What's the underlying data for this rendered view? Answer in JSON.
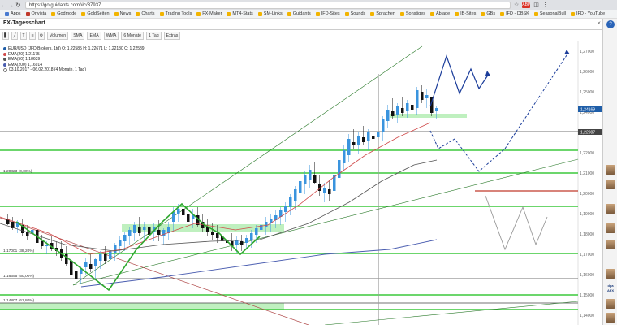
{
  "browser": {
    "url": "https://go.guidants.com/#c/37937",
    "extension_badge": "ABP",
    "bookmarks": [
      "Apps",
      "Onvista",
      "Godmode",
      "GoldSeiten",
      "News",
      "Charts",
      "Trading Tools",
      "FX-Maker",
      "MT4-Stats",
      "SM-Links",
      "Guidants",
      "IFD-Sites",
      "Sounds",
      "Sprachen",
      "Sonstiges",
      "Ablage",
      "IB-Sites",
      "GBs",
      "IFD - DBSK",
      "SeasonalBull",
      "IFD - YouTube"
    ]
  },
  "app": {
    "title": "FX-Tagesschart",
    "close_symbol": "×",
    "help_symbol": "?"
  },
  "toolbar": {
    "items": [
      "Volumen",
      "SMA",
      "EMA",
      "WMA",
      "6 Monate",
      "1 Tag",
      "Extras"
    ]
  },
  "chart": {
    "legend": {
      "instrument": "EUR/USD (JFD Brokers, 1td)",
      "ohlc": "O: 1,22585  H: 1,22671  L: 1,22130  C: 1,22589",
      "ema20": "EMA(20) 1,21175",
      "ema50": "EMA(50) 1,18639",
      "ema200": "EMA(200) 1,16914",
      "range": "03.10.2017 - 06.02.2018 (4 Monate, 1 Tag)"
    },
    "fib_labels": [
      {
        "text": "1,20823 (0,00%)"
      },
      {
        "text": "1,17001 (38,20%)"
      },
      {
        "text": "1,16655 (50,00%)"
      },
      {
        "text": "1,14807 (61,80%)"
      }
    ],
    "price_axis": [
      "1,27000",
      "1,26000",
      "1,25000",
      "1,24000",
      "1,23000",
      "1,22000",
      "1,21000",
      "1,20000",
      "1,19000",
      "1,18000",
      "1,17000",
      "1,16000",
      "1,15000",
      "1,14000"
    ],
    "price_badges": [
      {
        "text": "1,24169",
        "color": "#1f5ea8"
      },
      {
        "text": "1,22987",
        "color": "#444444"
      }
    ],
    "colors": {
      "bull": "#3a94de",
      "bear": "#111111",
      "ema20": "#d04a4a",
      "ema50": "#555555",
      "ema200": "#4a5db0",
      "green": "#3cc83c",
      "green_fill": "#bff0bf",
      "forecast": "#1a3c9a",
      "red_line": "#c0392b"
    }
  },
  "sidebar": {
    "help": "?"
  }
}
